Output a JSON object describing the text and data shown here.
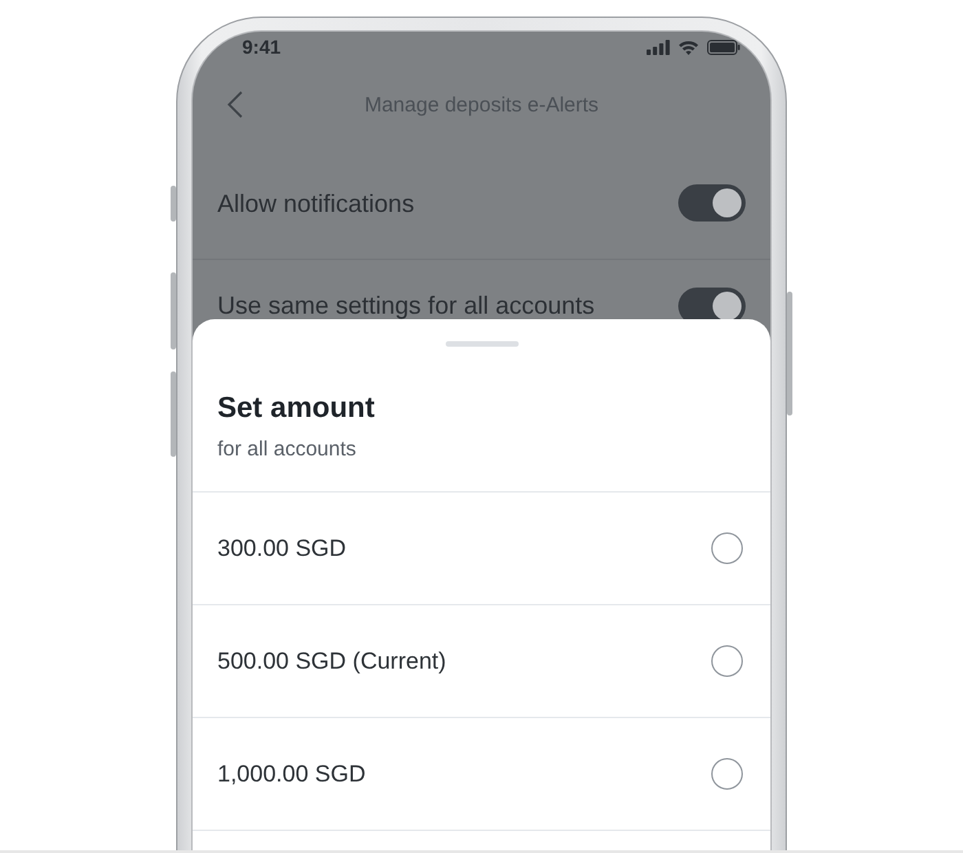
{
  "status_bar": {
    "time": "9:41"
  },
  "header": {
    "title": "Manage deposits e-Alerts"
  },
  "settings": [
    {
      "label": "Allow notifications",
      "on": true
    },
    {
      "label": "Use same settings for all accounts",
      "on": true
    }
  ],
  "sheet": {
    "title": "Set amount",
    "subtitle": "for all accounts",
    "options": [
      {
        "label": "300.00 SGD",
        "selected": false
      },
      {
        "label": "500.00 SGD (Current)",
        "selected": false
      },
      {
        "label": "1,000.00 SGD",
        "selected": false
      }
    ]
  }
}
